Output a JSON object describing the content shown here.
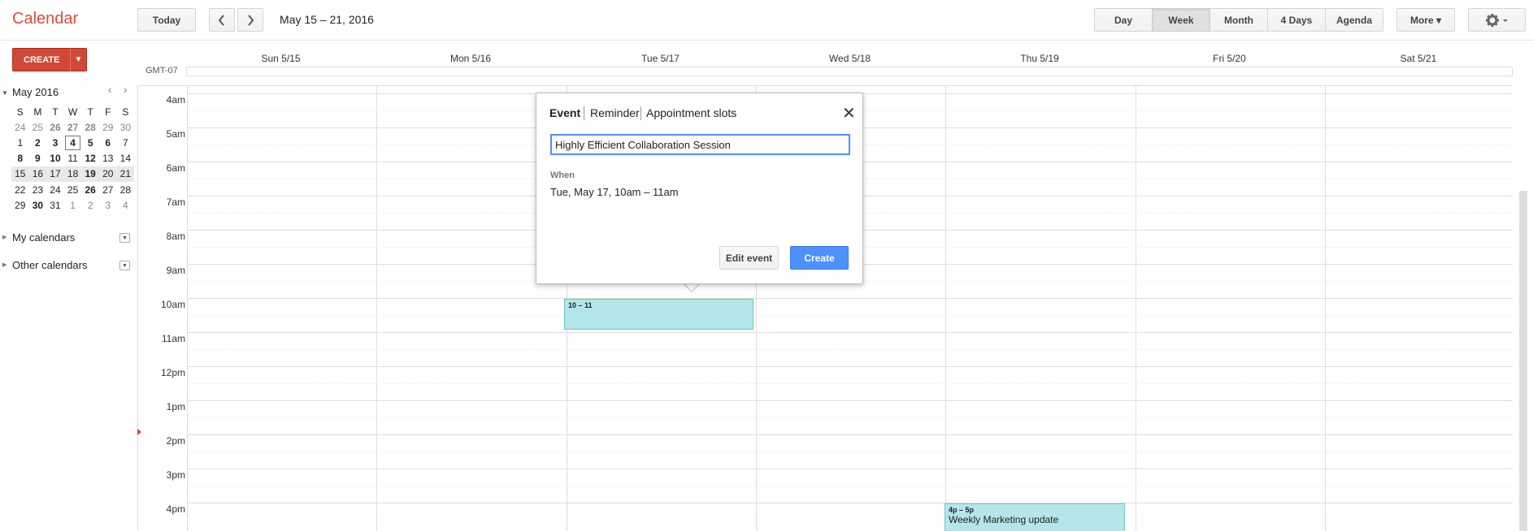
{
  "header": {
    "app_title": "Calendar",
    "today_label": "Today",
    "prev_icon": "chevron-left-icon",
    "next_icon": "chevron-right-icon",
    "date_range": "May 15 – 21, 2016",
    "views": [
      "Day",
      "Week",
      "Month",
      "4 Days",
      "Agenda"
    ],
    "selected_view": "Week",
    "more_label": "More ▾",
    "settings_icon": "gear-icon"
  },
  "sidebar": {
    "create_label": "CREATE",
    "mini_month": "May 2016",
    "weekday_initials": [
      "S",
      "M",
      "T",
      "W",
      "T",
      "F",
      "S"
    ],
    "weeks": [
      [
        "24",
        "25",
        "26",
        "27",
        "28",
        "29",
        "30"
      ],
      [
        "1",
        "2",
        "3",
        "4",
        "5",
        "6",
        "7"
      ],
      [
        "8",
        "9",
        "10",
        "11",
        "12",
        "13",
        "14"
      ],
      [
        "15",
        "16",
        "17",
        "18",
        "19",
        "20",
        "21"
      ],
      [
        "22",
        "23",
        "24",
        "25",
        "26",
        "27",
        "28"
      ],
      [
        "29",
        "30",
        "31",
        "1",
        "2",
        "3",
        "4"
      ]
    ],
    "my_calendars": "My calendars",
    "other_calendars": "Other calendars"
  },
  "grid": {
    "timezone": "GMT-07",
    "days": [
      "Sun 5/15",
      "Mon 5/16",
      "Tue 5/17",
      "Wed 5/18",
      "Thu 5/19",
      "Fri 5/20",
      "Sat 5/21"
    ],
    "hours": [
      "4am",
      "5am",
      "6am",
      "7am",
      "8am",
      "9am",
      "10am",
      "11am",
      "12pm",
      "1pm",
      "2pm",
      "3pm",
      "4pm"
    ]
  },
  "events": [
    {
      "time": "10 – 11",
      "title": ""
    },
    {
      "time": "4p – 5p",
      "title": "Weekly Marketing update"
    }
  ],
  "popup": {
    "tabs": [
      "Event",
      "Reminder",
      "Appointment slots"
    ],
    "title_value": "Highly Efficient Collaboration Session",
    "when_label": "When",
    "when_value": "Tue, May 17, 10am – 11am",
    "edit_label": "Edit event",
    "create_label": "Create"
  }
}
